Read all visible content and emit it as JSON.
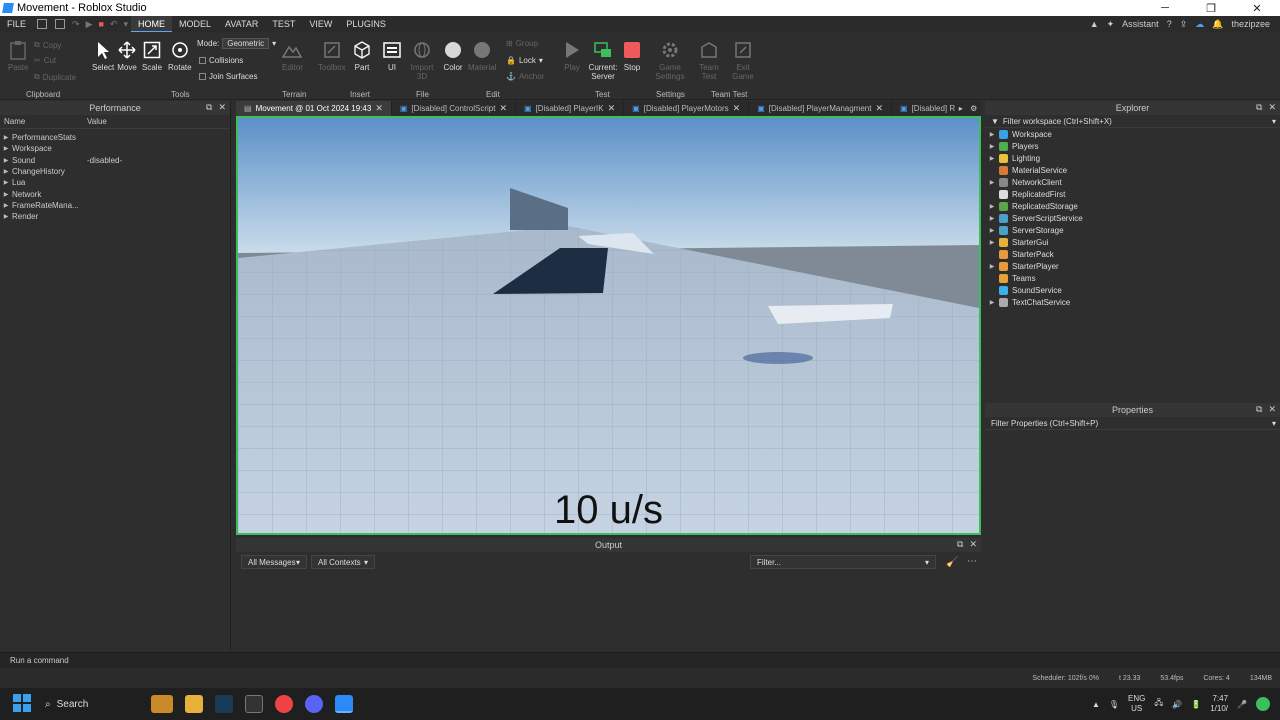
{
  "window": {
    "title": "Movement - Roblox Studio"
  },
  "menu": {
    "items": [
      "FILE",
      "HOME",
      "MODEL",
      "AVATAR",
      "TEST",
      "VIEW",
      "PLUGINS"
    ],
    "active": "HOME",
    "assistant": "Assistant",
    "user": "thezipzee"
  },
  "ribbon": {
    "clipboard": {
      "paste": "Paste",
      "copy": "Copy",
      "cut": "Cut",
      "duplicate": "Duplicate",
      "group_label": "Clipboard"
    },
    "tools": {
      "select": "Select",
      "move": "Move",
      "scale": "Scale",
      "rotate": "Rotate",
      "mode_label": "Mode:",
      "mode_value": "Geometric",
      "collisions": "Collisions",
      "join_surfaces": "Join Surfaces",
      "group_label": "Tools"
    },
    "terrain": {
      "editor": "Editor",
      "group_label": "Terrain"
    },
    "insert": {
      "toolbox": "Toolbox",
      "part": "Part",
      "ui": "UI",
      "group_label": "Insert"
    },
    "file": {
      "import3d": "Import 3D",
      "group_label": "File"
    },
    "edit": {
      "color": "Color",
      "material": "Material",
      "group": "Group",
      "lock": "Lock",
      "anchor": "Anchor",
      "group_label": "Edit"
    },
    "test": {
      "play": "Play",
      "current_server": "Current: Server",
      "stop": "Stop",
      "group_label": "Test"
    },
    "settings": {
      "game_settings": "Game Settings",
      "group_label": "Settings"
    },
    "team_test": {
      "team_test": "Team Test",
      "exit_game": "Exit Game",
      "group_label": "Team Test"
    }
  },
  "performance": {
    "title": "Performance",
    "columns": [
      "Name",
      "Value"
    ],
    "rows": [
      {
        "name": "PerformanceStats",
        "value": ""
      },
      {
        "name": "Workspace",
        "value": ""
      },
      {
        "name": "Sound",
        "value": "-disabled-"
      },
      {
        "name": "ChangeHistory",
        "value": ""
      },
      {
        "name": "Lua",
        "value": ""
      },
      {
        "name": "Network",
        "value": ""
      },
      {
        "name": "FrameRateMana...",
        "value": ""
      },
      {
        "name": "Render",
        "value": ""
      }
    ]
  },
  "tabs": [
    {
      "label": "Movement @ 01 Oct 2024 19:43",
      "active": true
    },
    {
      "label": "[Disabled] ControlScript",
      "active": false
    },
    {
      "label": "[Disabled] PlayerIK",
      "active": false
    },
    {
      "label": "[Disabled] PlayerMotors",
      "active": false
    },
    {
      "label": "[Disabled] PlayerManagment",
      "active": false
    },
    {
      "label": "[Disabled] Rai",
      "active": false
    }
  ],
  "viewport": {
    "speed_text": "10 u/s"
  },
  "output": {
    "title": "Output",
    "messages_filter": "All Messages",
    "contexts_filter": "All Contexts",
    "filter_placeholder": "Filter..."
  },
  "explorer": {
    "title": "Explorer",
    "filter": "Filter workspace (Ctrl+Shift+X)",
    "items": [
      {
        "name": "Workspace",
        "color": "#3aa0e8",
        "expand": true
      },
      {
        "name": "Players",
        "color": "#4fae4f",
        "expand": true
      },
      {
        "name": "Lighting",
        "color": "#e8c23a",
        "expand": true
      },
      {
        "name": "MaterialService",
        "color": "#d87a3a",
        "expand": false
      },
      {
        "name": "NetworkClient",
        "color": "#888888",
        "expand": true
      },
      {
        "name": "ReplicatedFirst",
        "color": "#dddddd",
        "expand": false
      },
      {
        "name": "ReplicatedStorage",
        "color": "#5aa64a",
        "expand": true
      },
      {
        "name": "ServerScriptService",
        "color": "#4aa0c8",
        "expand": true
      },
      {
        "name": "ServerStorage",
        "color": "#4aa0c8",
        "expand": true
      },
      {
        "name": "StarterGui",
        "color": "#e8b23a",
        "expand": true
      },
      {
        "name": "StarterPack",
        "color": "#e89a3a",
        "expand": false
      },
      {
        "name": "StarterPlayer",
        "color": "#e89a3a",
        "expand": true
      },
      {
        "name": "Teams",
        "color": "#e8a03a",
        "expand": false
      },
      {
        "name": "SoundService",
        "color": "#3ab0e8",
        "expand": false
      },
      {
        "name": "TextChatService",
        "color": "#aaaaaa",
        "expand": true
      }
    ]
  },
  "properties": {
    "title": "Properties",
    "filter": "Filter Properties (Ctrl+Shift+P)"
  },
  "command_bar": {
    "placeholder": "Run a command"
  },
  "status_bar": {
    "scheduler": "Scheduler: 102f/s 0%",
    "time": "t 23.33",
    "fps": "53.4fps",
    "cores": "Cores: 4",
    "memory": "134MB"
  },
  "taskbar": {
    "search": "Search",
    "lang_top": "ENG",
    "lang_bottom": "US",
    "clock_time": "7:47",
    "clock_date": "1/10/"
  }
}
